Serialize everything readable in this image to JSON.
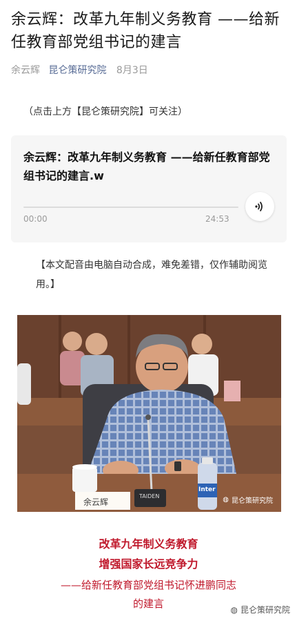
{
  "article": {
    "title": "余云辉：改革九年制义务教育 ——给新任教育部党组书记的建言",
    "author": "余云辉",
    "account": "昆仑策研究院",
    "date": "8月3日"
  },
  "notice": "（点击上方【昆仑策研究院】可关注）",
  "audio": {
    "title": "余云辉：改革九年制义务教育 ——给新任教育部党组书记的建言.w",
    "current_time": "00:00",
    "duration": "24:53",
    "progress": 0
  },
  "disclaimer": "【本文配音由电脑自动合成，难免差错，仅作辅助阅览用。】",
  "photo": {
    "nameplate": "余云辉",
    "mic_brand": "TAIDEN",
    "bottle_label": "Inter",
    "watermark": "昆仑策研究院"
  },
  "caption": {
    "line1": "改革九年制义务教育",
    "line2": "增强国家长远竞争力",
    "line3": "——给新任教育部党组书记怀进鹏同志",
    "line4": "的建言"
  },
  "watermark": "昆仑策研究院",
  "colors": {
    "accent_red": "#c0192c",
    "link_blue": "#576b95"
  }
}
